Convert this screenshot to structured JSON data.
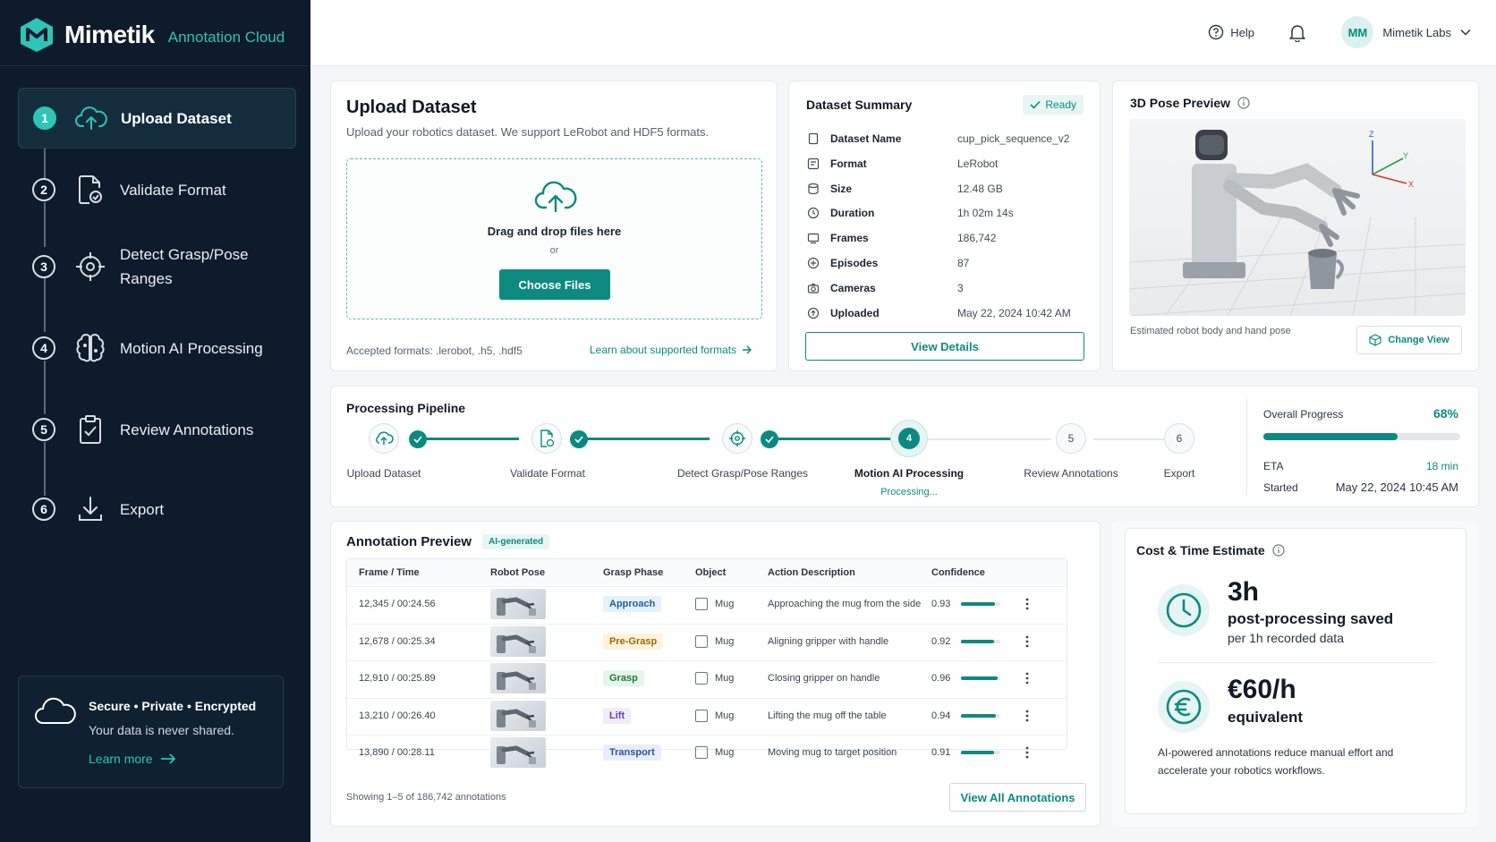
{
  "brand": {
    "name": "Mimetik",
    "tagline": "Annotation Cloud"
  },
  "sidebar": {
    "steps": [
      {
        "num": "1",
        "label": "Upload Dataset",
        "icon": "cloud-upload-icon",
        "active": true
      },
      {
        "num": "2",
        "label": "Validate Format",
        "icon": "file-check-icon"
      },
      {
        "num": "3",
        "label": "Detect Grasp/Pose Ranges",
        "icon": "crosshair-icon"
      },
      {
        "num": "4",
        "label": "Motion AI Processing",
        "icon": "brain-icon"
      },
      {
        "num": "5",
        "label": "Review Annotations",
        "icon": "clipboard-check-icon"
      },
      {
        "num": "6",
        "label": "Export",
        "icon": "download-icon"
      }
    ],
    "secure": {
      "title": "Secure • Private • Encrypted",
      "subtitle": "Your data is never shared.",
      "link": "Learn more"
    }
  },
  "topbar": {
    "help": "Help",
    "user_initials": "MM",
    "user_name": "Mimetik Labs"
  },
  "upload": {
    "title": "Upload Dataset",
    "subtitle": "Upload your robotics dataset. We support LeRobot and HDF5 formats.",
    "drop_text": "Drag and drop files here",
    "or": "or",
    "button": "Choose Files",
    "accepted": "Accepted formats: .lerobot, .h5, .hdf5",
    "learn_link": "Learn about supported formats"
  },
  "summary": {
    "title": "Dataset Summary",
    "status": "Ready",
    "rows": [
      {
        "key": "Dataset Name",
        "value": "cup_pick_sequence_v2",
        "icon": "file-icon"
      },
      {
        "key": "Format",
        "value": "LeRobot",
        "icon": "format-icon"
      },
      {
        "key": "Size",
        "value": "12.48 GB",
        "icon": "database-icon"
      },
      {
        "key": "Duration",
        "value": "1h 02m 14s",
        "icon": "clock-icon"
      },
      {
        "key": "Frames",
        "value": "186,742",
        "icon": "frames-icon"
      },
      {
        "key": "Episodes",
        "value": "87",
        "icon": "episodes-icon"
      },
      {
        "key": "Cameras",
        "value": "3",
        "icon": "camera-icon"
      },
      {
        "key": "Uploaded",
        "value": "May 22, 2024 10:42 AM",
        "icon": "upload-icon"
      }
    ],
    "button": "View Details"
  },
  "pose": {
    "title": "3D Pose Preview",
    "caption": "Estimated robot body and hand pose",
    "button": "Change View",
    "axes": {
      "z": "Z",
      "y": "Y",
      "x": "X"
    }
  },
  "pipeline": {
    "title": "Processing Pipeline",
    "steps": [
      {
        "label": "Upload Dataset",
        "status": "done",
        "icon": "cloud-upload-icon"
      },
      {
        "label": "Validate Format",
        "status": "done",
        "icon": "file-check-icon"
      },
      {
        "label": "Detect Grasp/Pose Ranges",
        "status": "done",
        "icon": "crosshair-icon"
      },
      {
        "label": "Motion AI Processing",
        "status": "active",
        "num": "4",
        "sub": "Processing..."
      },
      {
        "label": "Review Annotations",
        "status": "pending",
        "num": "5"
      },
      {
        "label": "Export",
        "status": "pending",
        "num": "6"
      }
    ],
    "progress": {
      "label": "Overall Progress",
      "value": "68%",
      "fraction": 0.68,
      "eta_label": "ETA",
      "eta": "18 min",
      "started_label": "Started",
      "started": "May 22, 2024 10:45 AM"
    }
  },
  "annotations": {
    "title": "Annotation Preview",
    "badge": "AI-generated",
    "columns": [
      "Frame / Time",
      "Robot Pose",
      "Grasp Phase",
      "Object",
      "Action Description",
      "Confidence"
    ],
    "rows": [
      {
        "frame": "12,345 / 00:24.56",
        "phase": "Approach",
        "object": "Mug",
        "action": "Approaching the mug from the side",
        "confidence": "0.93",
        "conf": 0.93
      },
      {
        "frame": "12,678 / 00:25.34",
        "phase": "Pre-Grasp",
        "object": "Mug",
        "action": "Aligning gripper with handle",
        "confidence": "0.92",
        "conf": 0.92
      },
      {
        "frame": "12,910 / 00:25.89",
        "phase": "Grasp",
        "object": "Mug",
        "action": "Closing gripper on handle",
        "confidence": "0.96",
        "conf": 0.96
      },
      {
        "frame": "13,210 / 00:26.40",
        "phase": "Lift",
        "object": "Mug",
        "action": "Lifting the mug off the table",
        "confidence": "0.94",
        "conf": 0.94
      },
      {
        "frame": "13,890 / 00:28.11",
        "phase": "Transport",
        "object": "Mug",
        "action": "Moving mug to target position",
        "confidence": "0.91",
        "conf": 0.91
      }
    ],
    "phase_colors": {
      "Approach": [
        "#e6f1fb",
        "#1f5f9e"
      ],
      "Pre-Grasp": [
        "#fdf3dc",
        "#9a6a08"
      ],
      "Grasp": [
        "#e5f5ea",
        "#1d7a3a"
      ],
      "Lift": [
        "#f1ebfb",
        "#6b3fb0"
      ],
      "Transport": [
        "#e7eefb",
        "#2c4fa8"
      ]
    },
    "footer": "Showing 1–5 of 186,742 annotations",
    "button": "View All Annotations"
  },
  "cost": {
    "title": "Cost & Time Estimate",
    "time_big": "3h",
    "time_mid": "post-processing saved",
    "time_sub": "per 1h recorded data",
    "price_big": "€60/h",
    "price_mid": "equivalent",
    "note": "AI-powered annotations reduce manual effort and accelerate your robotics workflows."
  }
}
